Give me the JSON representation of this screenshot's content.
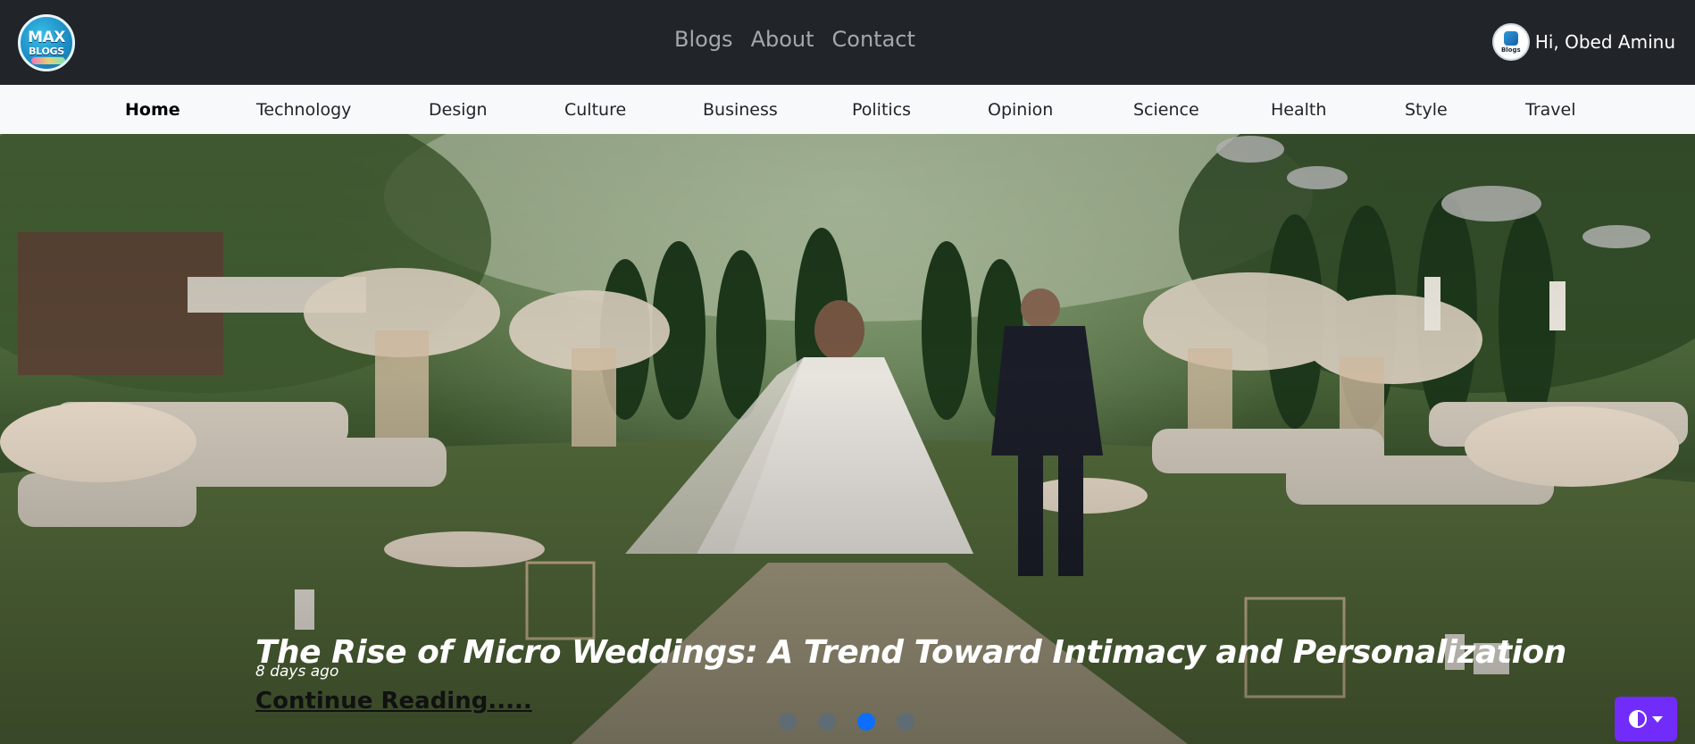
{
  "header": {
    "logo_text_line1": "MAX",
    "logo_text_line2": "BLOGS",
    "nav": [
      {
        "label": "Blogs"
      },
      {
        "label": "About"
      },
      {
        "label": "Contact"
      }
    ],
    "user": {
      "avatar_text": "Blogs",
      "greeting": "Hi, Obed Aminu"
    }
  },
  "categories": [
    {
      "label": "Home",
      "active": true
    },
    {
      "label": "Technology"
    },
    {
      "label": "Design"
    },
    {
      "label": "Culture"
    },
    {
      "label": "Business"
    },
    {
      "label": "Politics"
    },
    {
      "label": "Opinion"
    },
    {
      "label": "Science"
    },
    {
      "label": "Health"
    },
    {
      "label": "Style"
    },
    {
      "label": "Travel"
    }
  ],
  "hero": {
    "title": "The Rise of Micro Weddings: A Trend Toward Intimacy and Personalization",
    "time": "8 days ago",
    "link_label": "Continue Reading.....",
    "slide_count": 4,
    "active_slide": 3
  },
  "theme_toggle": {
    "icon": "contrast-half-circle-icon",
    "color": "#712cf9"
  },
  "colors": {
    "navbar_bg": "#212529",
    "category_bar_bg": "#f8f9fa",
    "indicator_active": "#0d6efd"
  }
}
